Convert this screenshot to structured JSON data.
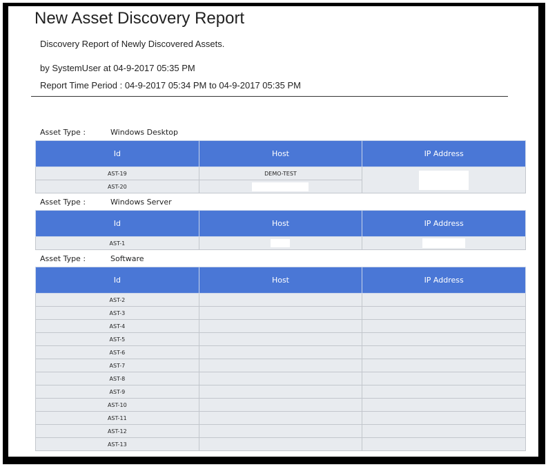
{
  "report": {
    "title": "New Asset Discovery Report",
    "description": "Discovery Report of Newly Discovered Assets.",
    "generated_by": "by SystemUser at 04-9-2017 05:35 PM",
    "time_period": "Report Time Period : 04-9-2017 05:34 PM to 04-9-2017 05:35 PM"
  },
  "asset_type_label": "Asset Type :",
  "columns": {
    "id": "Id",
    "host": "Host",
    "ip": "IP Address"
  },
  "sections": [
    {
      "type": "Windows Desktop",
      "rows": [
        {
          "id": "AST-19",
          "host": "DEMO-TEST",
          "ip": ""
        },
        {
          "id": "AST-20",
          "host": "",
          "ip": ""
        }
      ]
    },
    {
      "type": "Windows Server",
      "rows": [
        {
          "id": "AST-1",
          "host": "",
          "ip": ""
        }
      ]
    },
    {
      "type": "Software",
      "rows": [
        {
          "id": "AST-2",
          "host": "",
          "ip": ""
        },
        {
          "id": "AST-3",
          "host": "",
          "ip": ""
        },
        {
          "id": "AST-4",
          "host": "",
          "ip": ""
        },
        {
          "id": "AST-5",
          "host": "",
          "ip": ""
        },
        {
          "id": "AST-6",
          "host": "",
          "ip": ""
        },
        {
          "id": "AST-7",
          "host": "",
          "ip": ""
        },
        {
          "id": "AST-8",
          "host": "",
          "ip": ""
        },
        {
          "id": "AST-9",
          "host": "",
          "ip": ""
        },
        {
          "id": "AST-10",
          "host": "",
          "ip": ""
        },
        {
          "id": "AST-11",
          "host": "",
          "ip": ""
        },
        {
          "id": "AST-12",
          "host": "",
          "ip": ""
        },
        {
          "id": "AST-13",
          "host": "",
          "ip": ""
        }
      ]
    }
  ],
  "colors": {
    "header_bg": "#4a77d6",
    "row_bg": "#e8ebef",
    "redaction": "#ffffff"
  }
}
